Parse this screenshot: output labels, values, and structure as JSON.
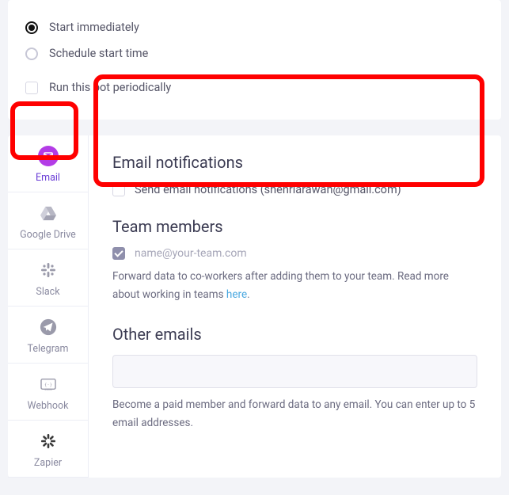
{
  "schedule": {
    "option_immediate": "Start immediately",
    "option_scheduled": "Schedule start time",
    "periodic_label": "Run this bot periodically"
  },
  "sidebar": {
    "items": [
      {
        "label": "Email"
      },
      {
        "label": "Google Drive"
      },
      {
        "label": "Slack"
      },
      {
        "label": "Telegram"
      },
      {
        "label": "Webhook"
      },
      {
        "label": "Zapier"
      }
    ]
  },
  "content": {
    "email_notifications": {
      "title": "Email notifications",
      "checkbox_label": "Send email notifications (shehriarawan@gmail.com)"
    },
    "team_members": {
      "title": "Team members",
      "placeholder": "name@your-team.com",
      "helper_pre": "Forward data to co-workers after adding them to your team. Read more about working in teams ",
      "helper_link": "here",
      "helper_post": "."
    },
    "other_emails": {
      "title": "Other emails",
      "helper": "Become a paid member and forward data to any email. You can enter up to 5 email addresses."
    }
  }
}
